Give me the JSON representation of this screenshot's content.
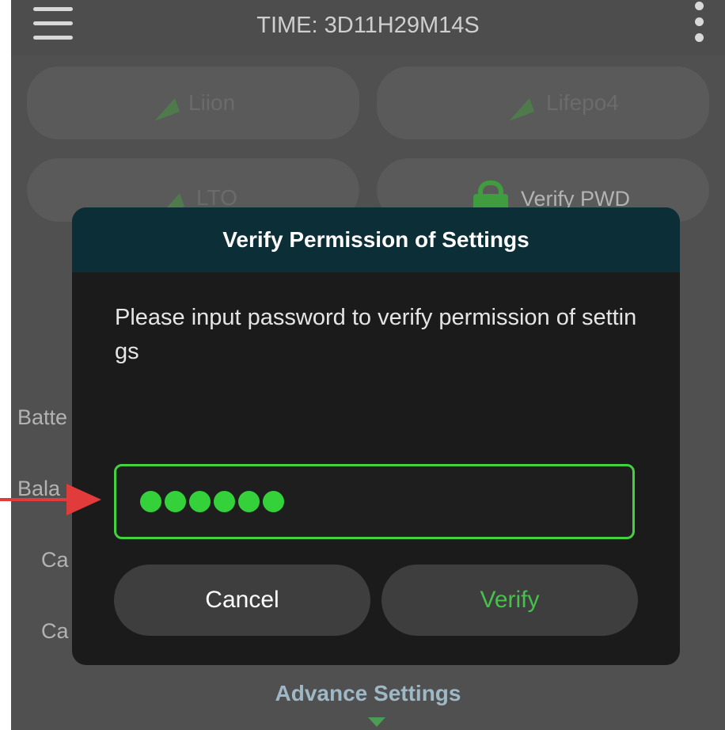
{
  "status": {
    "time_label": "TIME: 3D11H29M14S"
  },
  "background": {
    "battery_types": [
      "Liion",
      "Lifepo4",
      "LTO"
    ],
    "verify_pwd_label": "Verify PWD",
    "side_labels": [
      "Batte",
      "Bala",
      "Ca",
      "Ca"
    ],
    "advance_settings_label": "Advance Settings"
  },
  "dialog": {
    "title": "Verify Permission of Settings",
    "message": "Please input password to verify permission of settings",
    "password_dots": 6,
    "cancel_label": "Cancel",
    "verify_label": "Verify"
  },
  "colors": {
    "accent_green": "#43d140",
    "header_bg": "#0c2e36",
    "dialog_bg": "#1b1b1b",
    "arrow_red": "#e23b3b"
  },
  "icons": [
    "menu-icon",
    "more-vertical-icon",
    "paper-plane-icon",
    "lock-icon",
    "chevron-down-icon",
    "red-arrow-pointer"
  ]
}
